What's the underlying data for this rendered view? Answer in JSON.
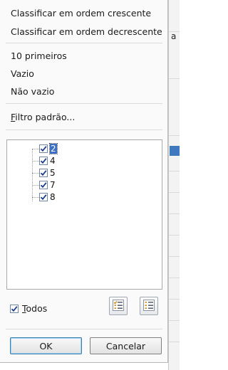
{
  "sheet_bg": {
    "letter": "a"
  },
  "menu": {
    "sort_asc": "Classificar em ordem crescente",
    "sort_desc": "Classificar em ordem decrescente",
    "top10": "10 primeiros",
    "empty": "Vazio",
    "not_empty": "Não vazio",
    "standard_filter_prefix": "F",
    "standard_filter_rest": "iltro padrão..."
  },
  "values": [
    {
      "label": "2",
      "checked": true,
      "selected": true
    },
    {
      "label": "4",
      "checked": true,
      "selected": false
    },
    {
      "label": "5",
      "checked": true,
      "selected": false
    },
    {
      "label": "7",
      "checked": true,
      "selected": false
    },
    {
      "label": "8",
      "checked": true,
      "selected": false
    }
  ],
  "all": {
    "prefix": "T",
    "rest": "odos",
    "checked": true
  },
  "icons": {
    "select_all": "checklist-check-icon",
    "deselect": "checklist-uncheck-icon"
  },
  "buttons": {
    "ok": "OK",
    "cancel": "Cancelar"
  },
  "colors": {
    "selection": "#3d6fc6",
    "check": "#1a3d8f"
  }
}
